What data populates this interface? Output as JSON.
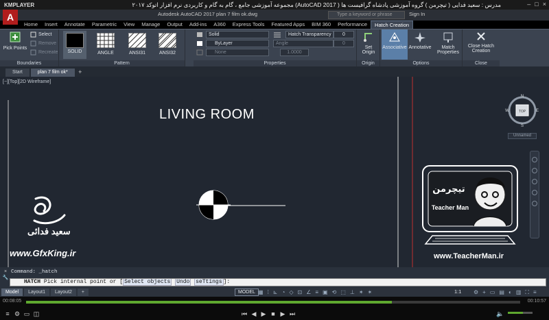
{
  "player": {
    "logo": "KMPLAYER",
    "caption": "مجموعه آموزشی جامع ، گام به گام و کاربردی نرم افزار  اتوکد ۲۰۱۷ (AutoCAD 2017 )  مدرس : سعید فدایی ( تیچرمن ) گروه آموزشی پادشاه گرافیست ها",
    "time_elapsed": "00:08:05",
    "time_total": "00:10:57",
    "progress": 0.74,
    "volume": 0.6
  },
  "app": {
    "logo_letter": "A",
    "file_title": "Autodesk AutoCAD 2017   plan 7 film ok.dwg",
    "search_placeholder": "Type a keyword or phrase",
    "sign_in": "Sign In"
  },
  "ribbon": {
    "tabs": [
      "Home",
      "Insert",
      "Annotate",
      "Parametric",
      "View",
      "Manage",
      "Output",
      "Add-ins",
      "A360",
      "Express Tools",
      "Featured Apps",
      "BIM 360",
      "Performance",
      "Hatch Creation"
    ],
    "active_tab": "Hatch Creation",
    "boundaries": {
      "pick_points": "Pick Points",
      "select": "Select",
      "remove": "Remove",
      "recreate": "Recreate",
      "label": "Boundaries"
    },
    "pattern": {
      "items": [
        "SOLID",
        "ANGLE",
        "ANSI31",
        "ANSI32"
      ],
      "label": "Pattern"
    },
    "properties": {
      "type": "Solid",
      "hatch_transparency_label": "Hatch Transparency",
      "transparency_value": "0",
      "color": "ByLayer",
      "angle_label": "Angle",
      "angle_value": "0",
      "background": "None",
      "scale_value": "1.0000",
      "label": "Properties"
    },
    "origin": {
      "set_origin": "Set Origin",
      "label": "Origin"
    },
    "options": {
      "associative": "Associative",
      "annotative": "Annotative",
      "match_properties": "Match Properties",
      "label": "Options"
    },
    "close": {
      "close_hatch": "Close Hatch Creation",
      "label": "Close"
    }
  },
  "doc_tabs": [
    "Start",
    "plan 7 film ok*"
  ],
  "active_doc": "plan 7 film ok*",
  "viewport": {
    "label": "[−][Top][2D Wireframe]",
    "viewcube_top": "TOP",
    "compass": {
      "n": "N",
      "s": "S",
      "e": "E",
      "w": "W"
    },
    "unnamed": "Unnamed"
  },
  "drawing": {
    "room_title": "LIVING ROOM"
  },
  "watermarks": {
    "left_name": "سعید فدائی",
    "left_site": "www.GfxKing.ir",
    "right_site": "www.TeacherMan.ir",
    "right_brand": "تیچرمن",
    "right_caption": "Teacher Man"
  },
  "command": {
    "history": "Command: _hatch",
    "prompt_cmd": "HATCH",
    "prompt_text": "Pick internal point or",
    "options": [
      "Select objects",
      "Undo",
      "seTtings"
    ],
    "prompt_end": "]:"
  },
  "status": {
    "layout_tabs": [
      "Model",
      "Layout1",
      "Layout2"
    ],
    "active_layout": "Model",
    "model": "MODEL",
    "scale": "1:1"
  }
}
